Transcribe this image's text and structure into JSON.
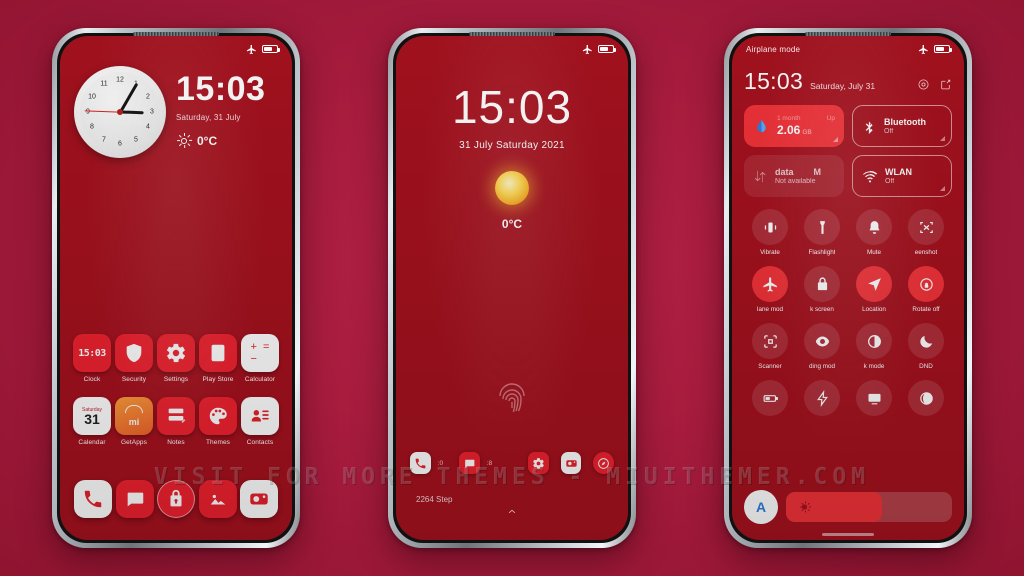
{
  "watermark": "VISIT FOR MORE THEMES - MIUITHEMER.COM",
  "theme": {
    "background": "#a81c3e",
    "screen_red": "#a6121f",
    "accent_red": "#f2333a",
    "white": "#ffffff",
    "auto_blue": "#2f7fe0"
  },
  "home_screen": {
    "status_bar": {
      "left_text": "",
      "plane_icon": "airplane-icon",
      "battery_icon": "battery-icon"
    },
    "clock_widget": {
      "name": "analog-clock-widget",
      "hours": "3",
      "minutes": "05",
      "seconds": "45",
      "numerals": [
        "12",
        "1",
        "2",
        "3",
        "4",
        "5",
        "6",
        "7",
        "8",
        "9",
        "10",
        "11"
      ]
    },
    "time": "15:03",
    "date": "Saturday, 31 July",
    "weather_icon": "sun-icon",
    "temperature": "0°C",
    "app_rows": [
      [
        {
          "label": "Clock",
          "icon": "clock-icon",
          "style": "red"
        },
        {
          "label": "Security",
          "icon": "shield-icon",
          "style": "red"
        },
        {
          "label": "Settings",
          "icon": "gear-icon",
          "style": "red"
        },
        {
          "label": "Play Store",
          "icon": "play-store-icon",
          "style": "red"
        },
        {
          "label": "Calculator",
          "icon": "calculator-icon",
          "style": "white"
        }
      ],
      [
        {
          "label": "Calendar",
          "icon": "calendar-icon",
          "style": "white",
          "day": "31",
          "weekday": "Saturday"
        },
        {
          "label": "GetApps",
          "icon": "getapps-icon",
          "style": "orange"
        },
        {
          "label": "Notes",
          "icon": "notes-icon",
          "style": "red"
        },
        {
          "label": "Themes",
          "icon": "palette-icon",
          "style": "red"
        },
        {
          "label": "Contacts",
          "icon": "contacts-icon",
          "style": "white"
        }
      ]
    ],
    "dock": [
      {
        "name": "phone-app",
        "icon": "phone-icon",
        "style": "white"
      },
      {
        "name": "messages-app",
        "icon": "message-icon",
        "style": "red"
      },
      {
        "name": "security-lock-app",
        "icon": "lock-icon",
        "style": "red"
      },
      {
        "name": "gallery-app",
        "icon": "gallery-icon",
        "style": "red"
      },
      {
        "name": "camera-app",
        "icon": "camera-icon",
        "style": "white"
      }
    ]
  },
  "lock_screen": {
    "status_bar": {
      "plane_icon": "airplane-icon",
      "battery_icon": "battery-icon"
    },
    "time": "15:03",
    "date": "31 July Saturday 2021",
    "weather_icon": "sun-icon",
    "temperature": "0°C",
    "fingerprint_icon": "fingerprint-icon",
    "shortcuts": [
      {
        "name": "phone-shortcut",
        "icon": "phone-icon",
        "badge": ":0",
        "style": "white"
      },
      {
        "name": "messages-shortcut",
        "icon": "message-icon",
        "badge": ":8",
        "style": "red"
      },
      {
        "name": "settings-shortcut",
        "icon": "gear-icon",
        "badge": "",
        "style": "red"
      },
      {
        "name": "camera-shortcut",
        "icon": "camera-icon",
        "badge": "",
        "style": "white"
      },
      {
        "name": "browser-shortcut",
        "icon": "compass-icon",
        "badge": "",
        "style": "red"
      }
    ],
    "steps": "2264 Step",
    "swipe_up_icon": "chevron-up-icon"
  },
  "control_center": {
    "status_bar": {
      "left_text": "Airplane mode",
      "plane_icon": "airplane-icon",
      "battery_icon": "battery-icon"
    },
    "time": "15:03",
    "date": "Saturday, July 31",
    "header_icons": [
      {
        "name": "settings-shortcut-icon",
        "icon": "gear-icon"
      },
      {
        "name": "edit-tiles-icon",
        "icon": "edit-icon"
      }
    ],
    "big_tiles": [
      {
        "name": "data-usage-tile",
        "state": "filled",
        "icon": "droplet-icon",
        "top_left": "1 month",
        "top_right": "Up",
        "value": "2.06",
        "unit": "GB"
      },
      {
        "name": "bluetooth-tile",
        "state": "outline",
        "icon": "bluetooth-icon",
        "title": "Bluetooth",
        "sub": "Off"
      },
      {
        "name": "mobile-data-tile",
        "state": "dim",
        "icon": "data-arrows-icon",
        "title": "data",
        "title2": "M",
        "sub": "Not available"
      },
      {
        "name": "wlan-tile",
        "state": "outline",
        "icon": "wifi-icon",
        "title": "WLAN",
        "sub": "Off"
      }
    ],
    "toggles": [
      {
        "label": "Vibrate",
        "icon": "vibrate-icon",
        "state": "off"
      },
      {
        "label": "Flashlight",
        "icon": "flashlight-icon",
        "state": "off"
      },
      {
        "label": "Mute",
        "icon": "bell-icon",
        "state": "off"
      },
      {
        "label": "eenshot",
        "icon": "screenshot-icon",
        "state": "off"
      },
      {
        "label": "lane mod",
        "icon": "airplane-icon",
        "state": "on"
      },
      {
        "label": "k screen",
        "icon": "lock-icon",
        "state": "off"
      },
      {
        "label": "Location",
        "icon": "location-icon",
        "state": "on"
      },
      {
        "label": "Rotate off",
        "icon": "rotate-lock-icon",
        "state": "on"
      },
      {
        "label": "Scanner",
        "icon": "scanner-icon",
        "state": "off"
      },
      {
        "label": "ding mod",
        "icon": "eye-icon",
        "state": "off"
      },
      {
        "label": "k mode",
        "icon": "contrast-icon",
        "state": "off"
      },
      {
        "label": "DND",
        "icon": "moon-icon",
        "state": "off"
      },
      {
        "label": "",
        "icon": "battery-saver-icon",
        "state": "off"
      },
      {
        "label": "",
        "icon": "bolt-icon",
        "state": "off"
      },
      {
        "label": "",
        "icon": "cast-icon",
        "state": "off"
      },
      {
        "label": "",
        "icon": "theme-contrast-icon",
        "state": "off"
      }
    ],
    "brightness": {
      "auto_label": "A",
      "icon": "brightness-icon",
      "level_percent": 58
    }
  }
}
